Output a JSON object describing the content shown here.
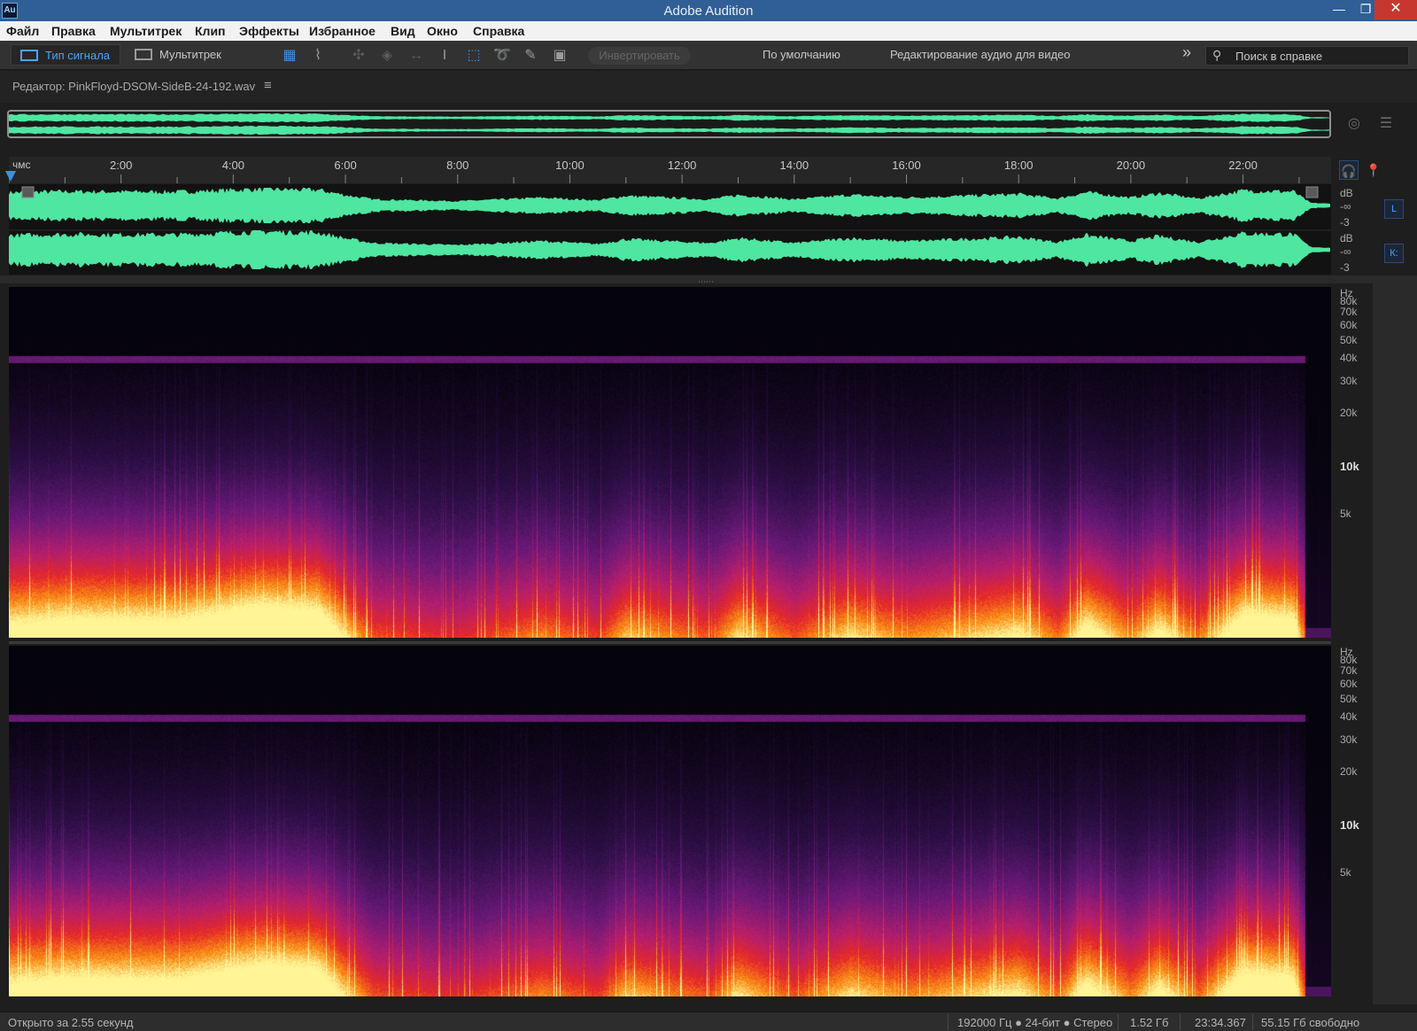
{
  "window": {
    "title": "Adobe Audition",
    "app_icon": "Au",
    "minimize_icon": "—",
    "restore_icon": "❐",
    "close_icon": "✕"
  },
  "menu": [
    "Файл",
    "Правка",
    "Мультитрек",
    "Клип",
    "Эффекты",
    "Избранное",
    "Вид",
    "Окно",
    "Справка"
  ],
  "toolbar": {
    "waveform_label": "Тип сигнала",
    "multitrack_label": "Мультитрек",
    "invert_label": "Инвертировать",
    "workspace_default": "По умолчанию",
    "workspace_video": "Редактирование аудио для видео",
    "more_icon": "»",
    "help_search_placeholder": "Поиск в справке"
  },
  "editor": {
    "label": "Редактор: PinkFloyd-DSOM-SideB-24-192.wav",
    "menu_icon": "≡"
  },
  "timeline": {
    "unit_label": "чмс",
    "ticks": [
      "2:00",
      "4:00",
      "6:00",
      "8:00",
      "10:00",
      "12:00",
      "14:00",
      "16:00",
      "18:00",
      "20:00",
      "22:00"
    ],
    "total_minutes": 23.57
  },
  "channels": {
    "left_label": "L",
    "right_label": "К:"
  },
  "db_scale": [
    "dB",
    "-∞",
    "-3"
  ],
  "hz_scale": [
    {
      "label": "Hz",
      "hz": 96000
    },
    {
      "label": "80k",
      "hz": 80000
    },
    {
      "label": "70k",
      "hz": 70000
    },
    {
      "label": "60k",
      "hz": 60000
    },
    {
      "label": "50k",
      "hz": 50000
    },
    {
      "label": "40k",
      "hz": 40000
    },
    {
      "label": "30k",
      "hz": 30000
    },
    {
      "label": "20k",
      "hz": 20000
    },
    {
      "label": "10k",
      "hz": 10000
    },
    {
      "label": "5k",
      "hz": 5000
    }
  ],
  "colors": {
    "waveform": "#4ee6a0",
    "accent": "#3d8fe6",
    "titlebar": "#2f5f96",
    "close": "#c7372f"
  },
  "status": {
    "open_time": "Открыто за 2.55 секунд",
    "format": "192000 Гц ● 24-бит ● Стерео",
    "size": "1.52 Гб",
    "duration": "23:34.367",
    "free": "55.15 Гб свободно"
  }
}
